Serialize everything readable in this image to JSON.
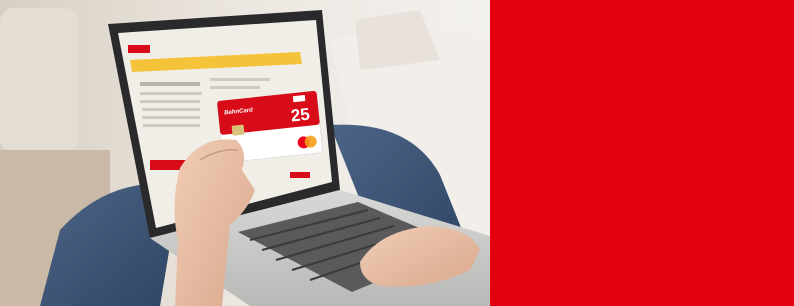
{
  "photo": {
    "card": {
      "brand_text": "BahnCard",
      "discount_number": "25"
    }
  },
  "panel": {
    "color": "#e3000f"
  }
}
